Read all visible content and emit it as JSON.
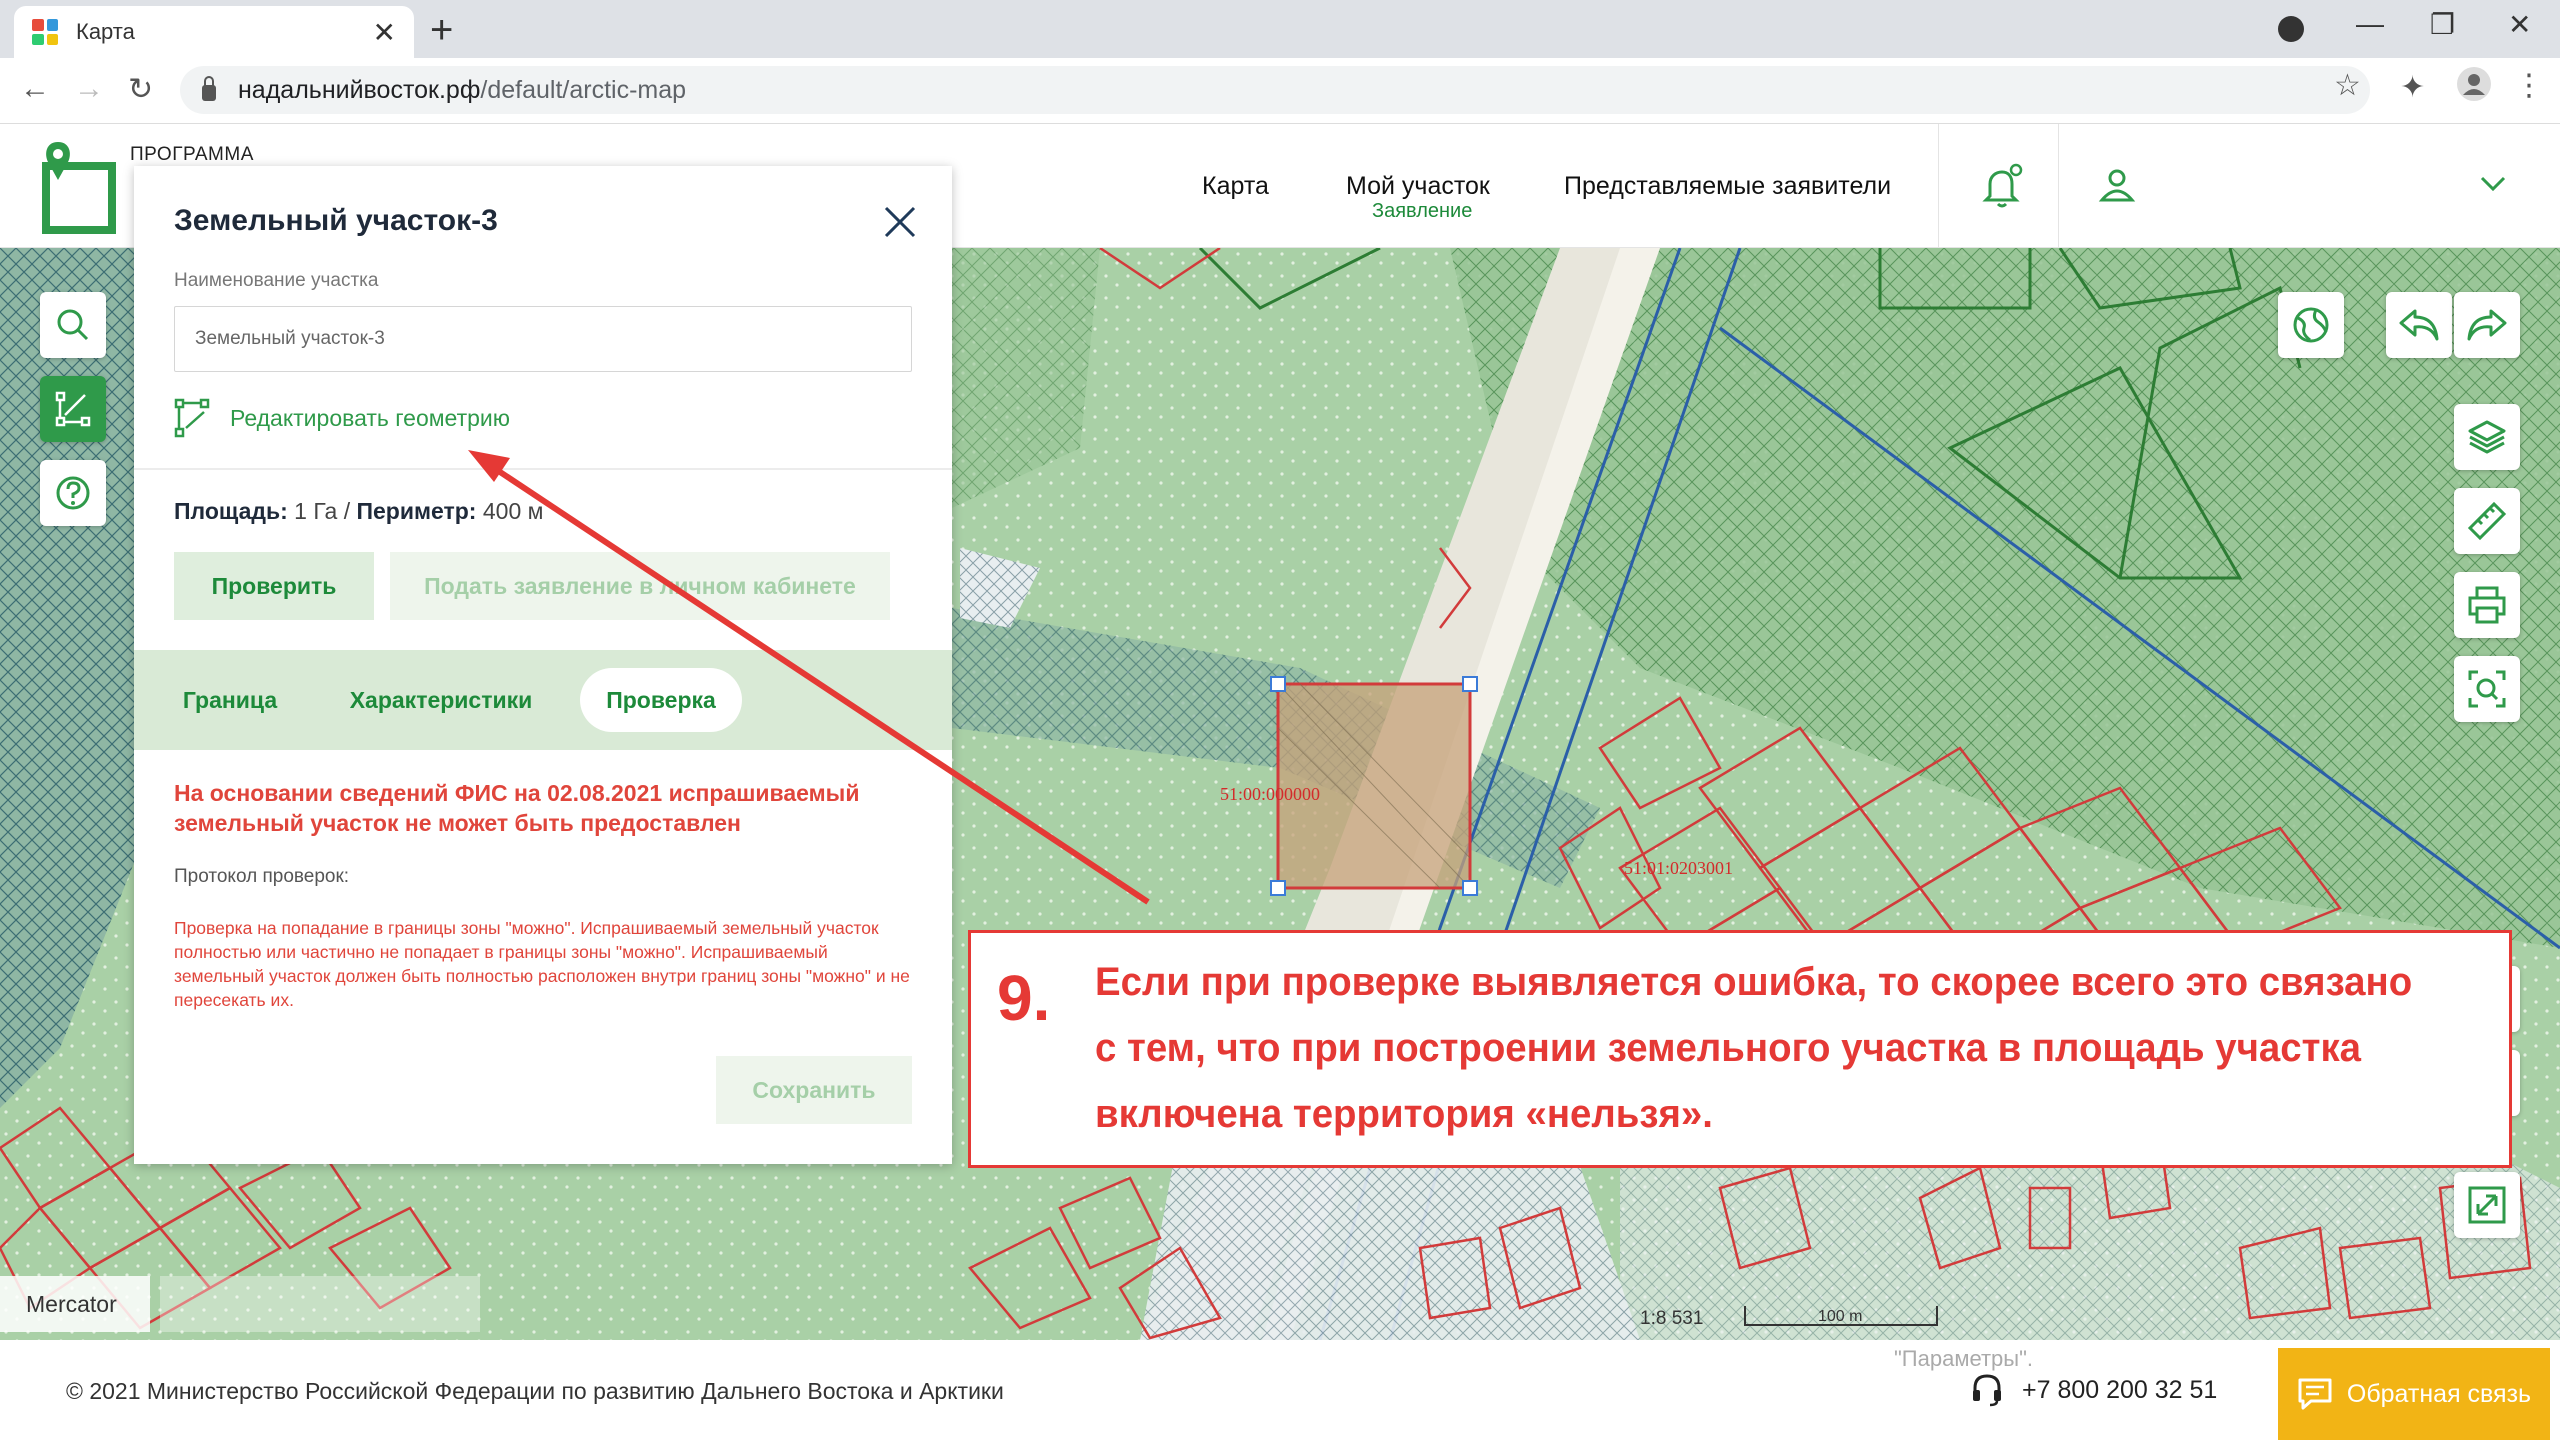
{
  "browser": {
    "tab_title": "Карта",
    "url_host": "надальнийвосток.рф",
    "url_path": "/default/arctic-map",
    "favicon_colors": [
      "#e74c3c",
      "#3498db",
      "#2ecc71",
      "#f1c40f"
    ]
  },
  "header": {
    "logo_text": "ПРОГРАММА",
    "nav": {
      "map": "Карта",
      "my_plot": "Мой участок",
      "my_plot_sub": "Заявление",
      "representatives": "Представляемые заявители"
    }
  },
  "panel": {
    "title": "Земельный участок-3",
    "name_label": "Наименование участка",
    "name_value": "Земельный участок-3",
    "edit_geometry": "Редактировать геометрию",
    "area_label": "Площадь:",
    "area_value": "1 Га",
    "separator": "/",
    "perimeter_label": "Периметр:",
    "perimeter_value": "400 м",
    "check_button": "Проверить",
    "submit_button": "Подать заявление в личном кабинете",
    "tabs": [
      "Граница",
      "Характеристики",
      "Проверка"
    ],
    "active_tab": "Проверка",
    "error_title": "На основании сведений ФИС на 02.08.2021 испрашиваемый земельный участок не может быть предоставлен",
    "protocol_label": "Протокол проверок:",
    "protocol_text": "Проверка на попадание в границы зоны \"можно\". Испрашиваемый земельный участок полностью или частично не попадает в границы зоны \"можно\". Испрашиваемый земельный участок должен быть полностью расположен внутри границ зоны \"можно\" и не пересекать их.",
    "save_button": "Сохранить"
  },
  "map": {
    "parcel_label_1": "51:00:000000",
    "parcel_label_2": "51:01:0203001",
    "projection": "Mercator",
    "scale": "1:8 531",
    "scale_bar_label": "100 m",
    "zoom_in": "+",
    "zoom_out": "−"
  },
  "annotation": {
    "number": "9.",
    "text": "Если при проверке выявляется ошибка, то скорее всего это связано с тем, что при построении земельного участка в площадь участка включена территория «нельзя».",
    "color": "#e53935"
  },
  "footer": {
    "copyright": "© 2021 Министерство Российской Федерации по развитию Дальнего Востока и Арктики",
    "params_tooltip": "\"Параметры\".",
    "phone": "+7 800 200 32 51",
    "feedback": "Обратная связь",
    "feedback_color": "#f2b415"
  },
  "colors": {
    "accent_green": "#2f9a4a",
    "error_red": "#e0453b"
  }
}
